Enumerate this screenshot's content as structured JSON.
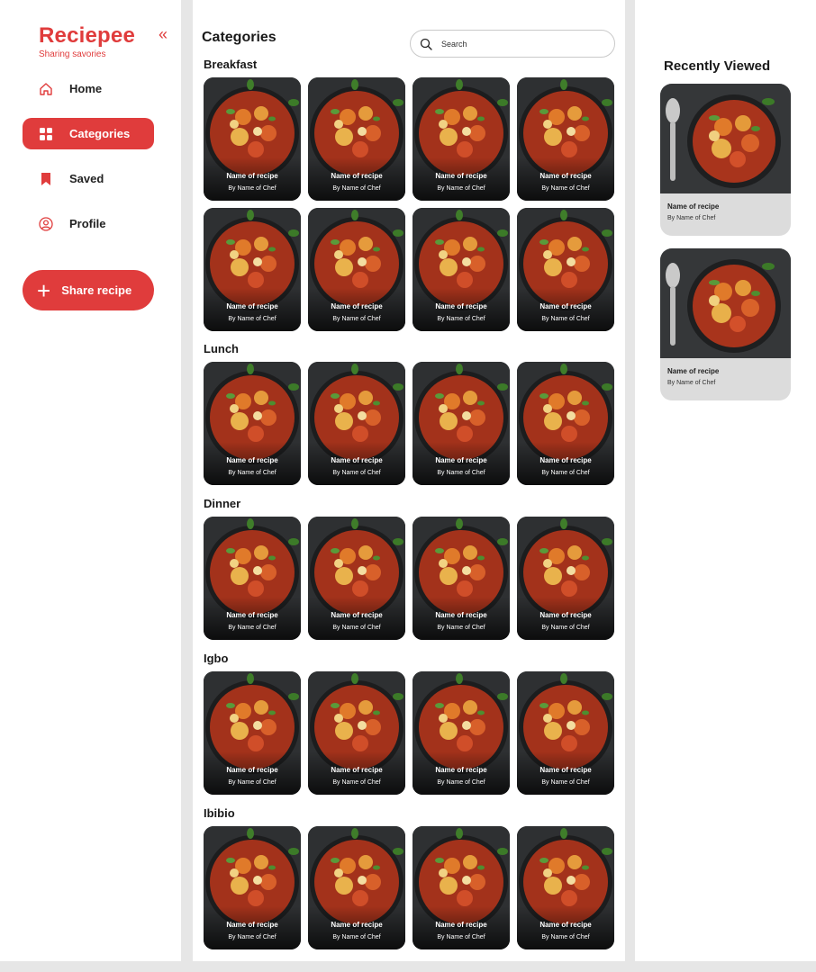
{
  "brand": {
    "name": "Reciepee",
    "tagline": "Sharing savories",
    "collapse_glyph": "«"
  },
  "colors": {
    "accent": "#e03c3c",
    "panel": "#ffffff",
    "background": "#e6e6e6"
  },
  "nav": [
    {
      "label": "Home",
      "icon": "home-icon",
      "active": false
    },
    {
      "label": "Categories",
      "icon": "grid-icon",
      "active": true
    },
    {
      "label": "Saved",
      "icon": "bookmark-icon",
      "active": false
    },
    {
      "label": "Profile",
      "icon": "profile-icon",
      "active": false
    }
  ],
  "share_button": {
    "label": "Share recipe",
    "icon": "plus-icon"
  },
  "main": {
    "title": "Categories",
    "search": {
      "placeholder": "Search",
      "icon": "search-icon"
    },
    "sections": [
      {
        "title": "Breakfast",
        "rows": 2
      },
      {
        "title": "Lunch",
        "rows": 1
      },
      {
        "title": "Dinner",
        "rows": 1
      },
      {
        "title": "Igbo",
        "rows": 1
      },
      {
        "title": "Ibibio",
        "rows": 1
      }
    ],
    "card": {
      "name": "Name of recipe",
      "chef": "By Name of Chef"
    }
  },
  "recently_viewed": {
    "title": "Recently Viewed",
    "items": [
      {
        "name": "Name of recipe",
        "chef": "By Name of Chef"
      },
      {
        "name": "Name of recipe",
        "chef": "By Name of Chef"
      }
    ]
  }
}
